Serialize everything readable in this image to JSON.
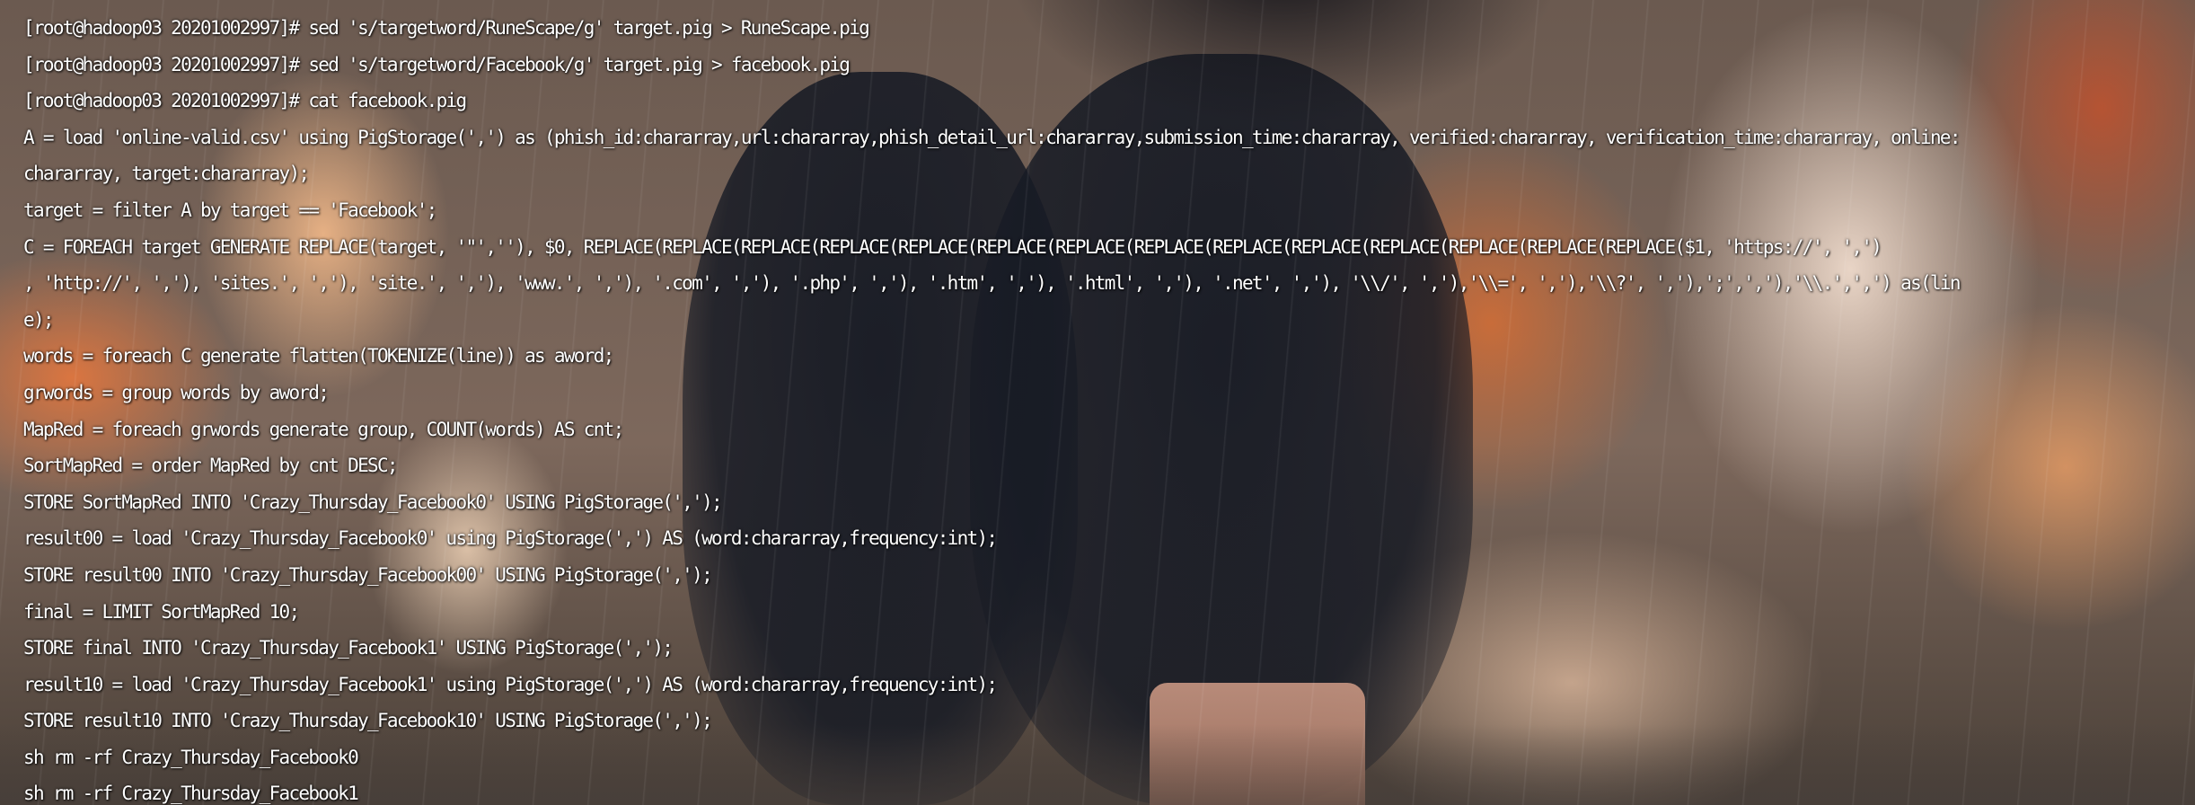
{
  "terminal": {
    "lines": [
      "[root@hadoop03 20201002997]# sed 's/targetword/RuneScape/g' target.pig > RuneScape.pig",
      "[root@hadoop03 20201002997]# sed 's/targetword/Facebook/g' target.pig > facebook.pig",
      "[root@hadoop03 20201002997]# cat facebook.pig",
      "A = load 'online-valid.csv' using PigStorage(',') as (phish_id:chararray,url:chararray,phish_detail_url:chararray,submission_time:chararray, verified:chararray, verification_time:chararray, online:",
      "chararray, target:chararray);",
      "target = filter A by target == 'Facebook';",
      "C = FOREACH target GENERATE REPLACE(target, '\"',''), $0, REPLACE(REPLACE(REPLACE(REPLACE(REPLACE(REPLACE(REPLACE(REPLACE(REPLACE(REPLACE(REPLACE(REPLACE(REPLACE(REPLACE($1, 'https://', ',')",
      ", 'http://', ','), 'sites.', ','), 'site.', ','), 'www.', ','), '.com', ','), '.php', ','), '.htm', ','), '.html', ','), '.net', ','), '\\\\/', ','),'\\\\=', ','),'\\\\?', ','),';',','),'\\\\.',',') as(lin",
      "e);",
      "words = foreach C generate flatten(TOKENIZE(line)) as aword;",
      "grwords = group words by aword;",
      "MapRed = foreach grwords generate group, COUNT(words) AS cnt;",
      "SortMapRed = order MapRed by cnt DESC;",
      "STORE SortMapRed INTO 'Crazy_Thursday_Facebook0' USING PigStorage(',');",
      "result00 = load 'Crazy_Thursday_Facebook0' using PigStorage(',') AS (word:chararray,frequency:int);",
      "STORE result00 INTO 'Crazy_Thursday_Facebook00' USING PigStorage(',');",
      "final = LIMIT SortMapRed 10;",
      "STORE final INTO 'Crazy_Thursday_Facebook1' USING PigStorage(',');",
      "result10 = load 'Crazy_Thursday_Facebook1' using PigStorage(',') AS (word:chararray,frequency:int);",
      "STORE result10 INTO 'Crazy_Thursday_Facebook10' USING PigStorage(',');",
      "sh rm -rf Crazy_Thursday_Facebook0",
      "sh rm -rf Crazy_Thursday_Facebook1"
    ]
  },
  "colors": {
    "text": "#ffffff",
    "wallpaper_warm": "#e07a40",
    "wallpaper_dark": "#161a24"
  }
}
